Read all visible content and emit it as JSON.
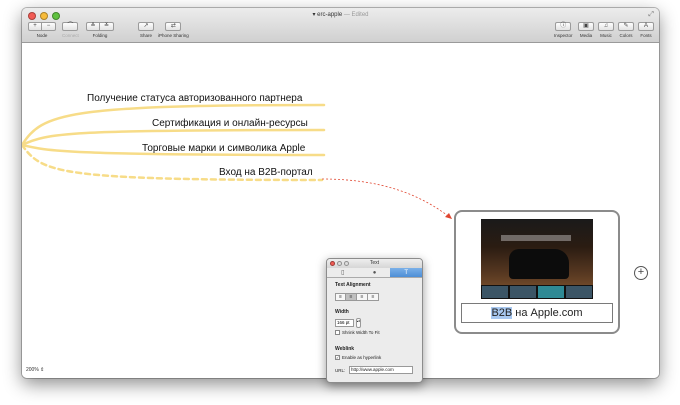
{
  "window": {
    "title_icon": "document-icon",
    "title": "erc-apple",
    "title_status": "— Edited"
  },
  "toolbar": {
    "node": {
      "add_label": "+",
      "remove_label": "−",
      "label": "Node"
    },
    "connect": {
      "label": "Connect"
    },
    "folding": {
      "label": "Folding"
    },
    "share": {
      "label": "Share"
    },
    "iphone_sharing": {
      "label": "iPhone Sharing"
    },
    "inspector": {
      "label": "Inspector"
    },
    "media": {
      "label": "Media"
    },
    "music": {
      "label": "Music"
    },
    "colors": {
      "label": "Colors"
    },
    "fonts": {
      "label": "Fonts"
    }
  },
  "mindmap": {
    "topics": [
      {
        "text": "Получение статуса авторизованного партнера"
      },
      {
        "text": "Сертификация и онлайн-ресурсы"
      },
      {
        "text": "Торговые марки и символика Apple"
      },
      {
        "text": "Вход на B2B-портал"
      }
    ],
    "linked_node": {
      "link_selected": "B2B",
      "link_rest": " на Apple.com"
    },
    "branch_color": "#f7dc88",
    "connector_color": "#e0452f"
  },
  "status": {
    "zoom": "200%"
  },
  "text_panel": {
    "title": "Text",
    "text_alignment_label": "Text Alignment",
    "width_label": "Width",
    "width_value": "166 pt",
    "shrink_label": "Shrink Width To Fit",
    "weblink_label": "Weblink",
    "enable_hyperlink_label": "Enable as hyperlink",
    "url_label": "URL:",
    "url_value": "http://www.apple.com"
  }
}
